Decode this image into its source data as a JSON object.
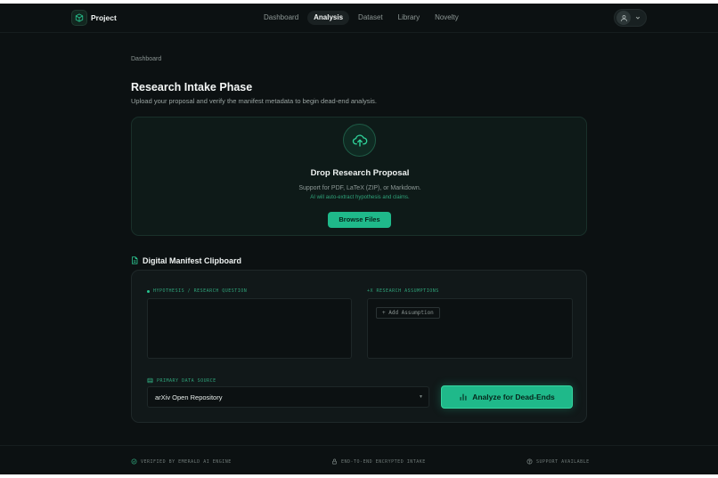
{
  "colors": {
    "accent": "#1fb98a",
    "background": "#0c1112",
    "panel": "#111819"
  },
  "header": {
    "brand_name": "Project",
    "brand_icon": "cube-icon",
    "nav": [
      "Dashboard",
      "Analysis",
      "Dataset",
      "Library",
      "Novelty"
    ],
    "active_nav": "Analysis",
    "user_icon": "user-icon"
  },
  "breadcrumb": "Dashboard",
  "page": {
    "title": "Research Intake Phase",
    "subtitle": "Upload your proposal and verify the manifest metadata to begin dead-end analysis."
  },
  "dropzone": {
    "icon": "cloud-upload-icon",
    "title": "Drop Research Proposal",
    "support": "Support for PDF, LaTeX (ZIP), or Markdown.",
    "hint": "AI will auto-extract hypothesis and claims.",
    "browse_label": "Browse Files"
  },
  "manifest": {
    "section_title": "Digital Manifest Clipboard",
    "section_icon": "document-icon",
    "hypothesis_label": "HYPOTHESIS / RESEARCH QUESTION",
    "hypothesis_value": "",
    "assumptions_label": "+X RESEARCH ASSUMPTIONS",
    "add_assumption_label": "+ Add Assumption",
    "data_source_label": "PRIMARY DATA SOURCE",
    "data_source_value": "arXiv Open Repository",
    "analyze_label": "Analyze for Dead-Ends",
    "analyze_icon": "bar-chart-icon"
  },
  "footer": {
    "verified": "VERIFIED BY EMERALD AI ENGINE",
    "encrypted": "END-TO-END ENCRYPTED INTAKE",
    "support": "SUPPORT AVAILABLE"
  }
}
